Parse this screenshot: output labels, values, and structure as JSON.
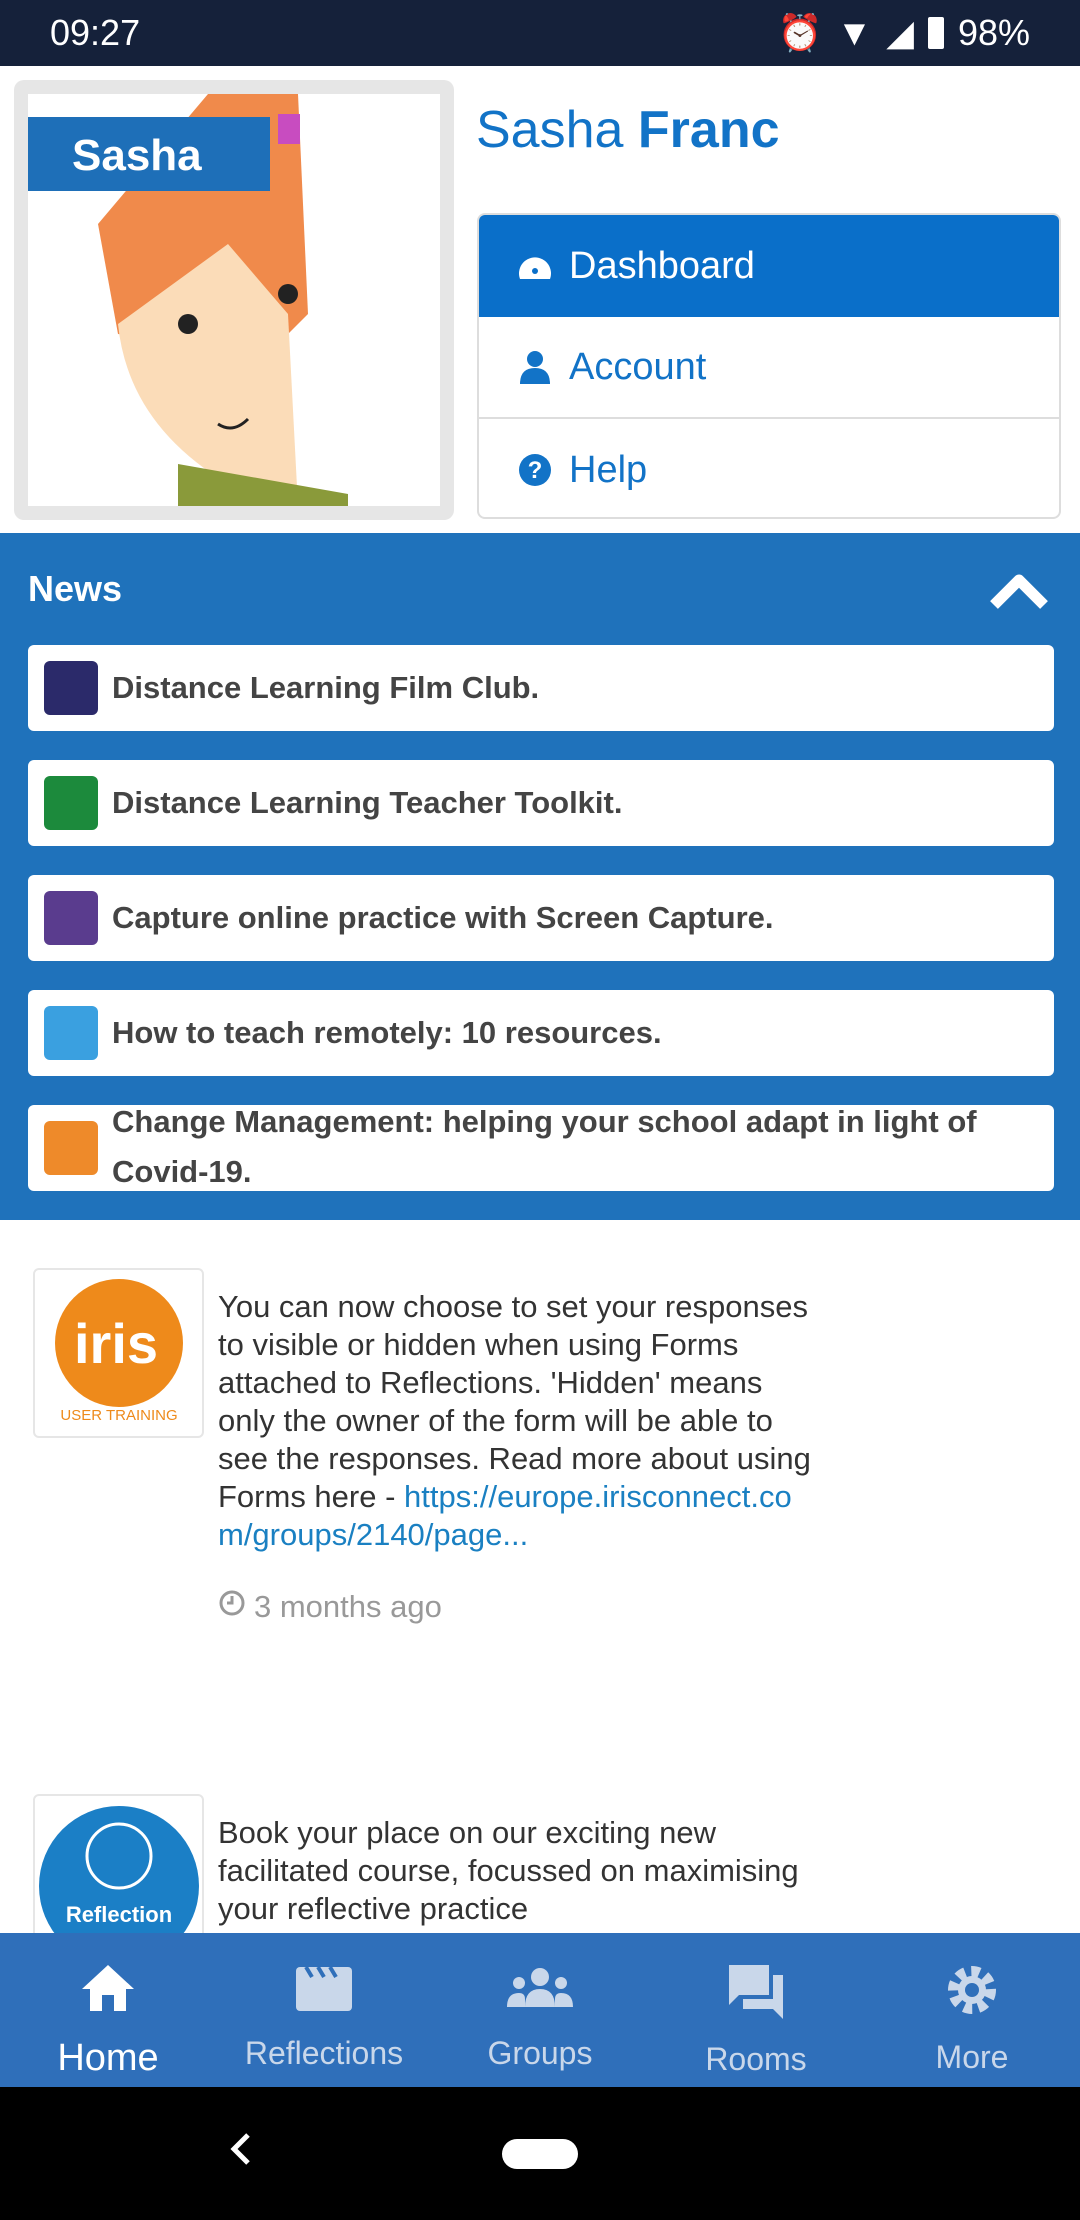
{
  "status": {
    "time": "09:27",
    "battery": "98%"
  },
  "profile": {
    "tag": "Sasha",
    "first_name": "Sasha",
    "last_name": "Franc"
  },
  "menu": [
    {
      "label": "Dashboard",
      "icon": "dashboard-icon",
      "active": true
    },
    {
      "label": "Account",
      "icon": "user-icon"
    },
    {
      "label": "Help",
      "icon": "question-circle-icon"
    }
  ],
  "news": {
    "title": "News",
    "items": [
      {
        "label": "Distance Learning Film Club.",
        "color": "#2b2a6a"
      },
      {
        "label": "Distance Learning Teacher Toolkit.",
        "color": "#1c8a3c"
      },
      {
        "label": "Capture online practice with Screen Capture.",
        "color": "#5a3c8e"
      },
      {
        "label": "How to teach remotely: 10 resources.",
        "color": "#3aa0e0"
      },
      {
        "label": "Change Management: helping your school adapt in light of Covid-19.",
        "color": "#ee8a2a"
      }
    ]
  },
  "posts": [
    {
      "logo_text": "iris",
      "logo_sub": "USER TRAINING",
      "text": "You can now choose to set your responses to visible or hidden when using Forms attached to Reflections. 'Hidden' means only the owner of the form will be able to see the responses. Read more about using Forms here - ",
      "link": "https://europe.irisconnect.com/groups/2140/page...",
      "time": "3 months ago"
    },
    {
      "logo_text": "Reflection Cycles",
      "text": "Book your place on our exciting new facilitated course, focussed on maximising your reflective practice"
    }
  ],
  "bottom_nav": [
    {
      "label": "Home",
      "icon": "home-icon",
      "active": true
    },
    {
      "label": "Reflections",
      "icon": "clapperboard-icon"
    },
    {
      "label": "Groups",
      "icon": "users-icon"
    },
    {
      "label": "Rooms",
      "icon": "chat-icon"
    },
    {
      "label": "More",
      "icon": "gear-icon"
    }
  ],
  "colors": {
    "primary": "#1f72bb",
    "active_menu": "#0a6fc9",
    "status_bar": "#15213a"
  }
}
